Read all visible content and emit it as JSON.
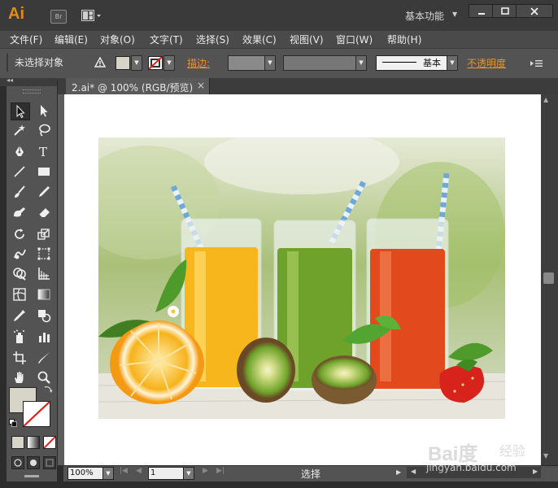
{
  "app": {
    "logo": "Ai",
    "bridge_button": "Br",
    "workspace": "基本功能"
  },
  "menu": [
    "文件(F)",
    "编辑(E)",
    "对象(O)",
    "文字(T)",
    "选择(S)",
    "效果(C)",
    "视图(V)",
    "窗口(W)",
    "帮助(H)"
  ],
  "control_bar": {
    "selection_status": "未选择对象",
    "stroke_label": "描边:",
    "brush_label": "基本",
    "opacity_label": "不透明度",
    "fill_color": "#d6d5c8",
    "accent_color": "#e8932b"
  },
  "document": {
    "tab_label": "2.ai* @ 100% (RGB/预览)",
    "tab_close": "×"
  },
  "status_bar": {
    "zoom": "100%",
    "page": "1",
    "tool_status": "选择"
  },
  "watermark": {
    "logo": "Bai度",
    "site": "经验",
    "url": "jingyan.baidu.com"
  },
  "tools": [
    "selection-tool",
    "direct-selection-tool",
    "magic-wand-tool",
    "lasso-tool",
    "pen-tool",
    "type-tool",
    "line-tool",
    "rectangle-tool",
    "paintbrush-tool",
    "pencil-tool",
    "blob-brush-tool",
    "eraser-tool",
    "rotate-tool",
    "scale-tool",
    "warp-tool",
    "free-transform-tool",
    "shape-builder-tool",
    "perspective-grid-tool",
    "mesh-tool",
    "gradient-tool",
    "eyedropper-tool",
    "blend-tool",
    "symbol-sprayer-tool",
    "column-graph-tool",
    "artboard-tool",
    "slice-tool",
    "hand-tool",
    "zoom-tool"
  ]
}
